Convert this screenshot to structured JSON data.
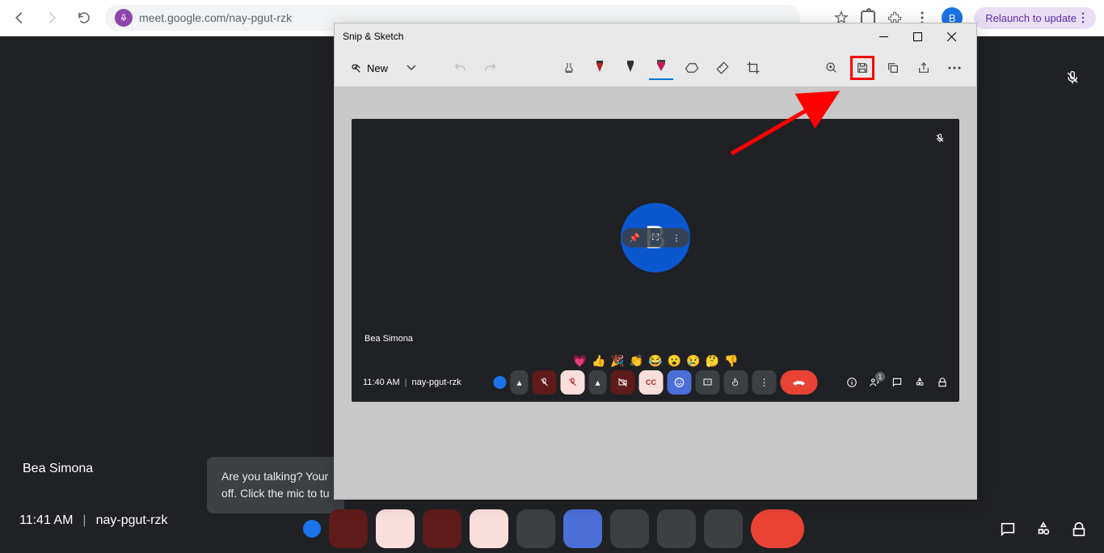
{
  "browser": {
    "url": "meet.google.com/nay-pgut-rzk",
    "profile_initial": "B",
    "relaunch_label": "Relaunch to update"
  },
  "meet_behind": {
    "participant_name": "Bea Simona",
    "toast": "Are you talking? Your off. Click the mic to tu",
    "time": "11:41 AM",
    "code": "nay-pgut-rzk"
  },
  "snip": {
    "title": "Snip & Sketch",
    "new_label": "New"
  },
  "inner_meet": {
    "avatar_initial": "B",
    "name": "Bea Simona",
    "time": "11:40 AM",
    "code": "nay-pgut-rzk",
    "emojis": [
      "💗",
      "👍",
      "🎉",
      "👏",
      "😂",
      "😮",
      "😢",
      "🤔",
      "👎"
    ],
    "people_count": "1"
  }
}
